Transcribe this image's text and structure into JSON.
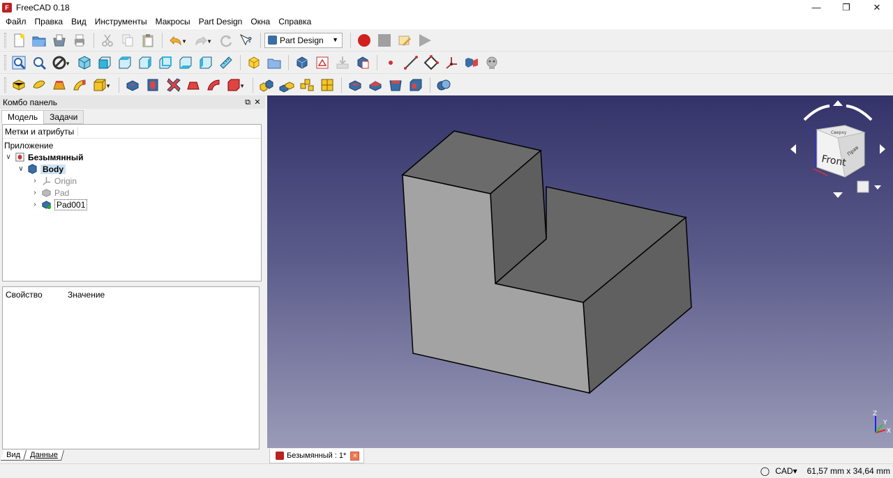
{
  "window": {
    "title": "FreeCAD 0.18",
    "app_icon_text": "F"
  },
  "menu": [
    "Файл",
    "Правка",
    "Вид",
    "Инструменты",
    "Макросы",
    "Part Design",
    "Окна",
    "Справка"
  ],
  "toolbar": {
    "workbench": "Part Design"
  },
  "combo": {
    "title": "Комбо панель",
    "tabs": [
      "Модель",
      "Задачи"
    ],
    "tree_header": "Метки и атрибуты",
    "app_label": "Приложение",
    "document": "Безымянный",
    "body": "Body",
    "children": [
      "Origin",
      "Pad",
      "Pad001"
    ],
    "prop_cols": [
      "Свойство",
      "Значение"
    ],
    "bottom_tabs": [
      "Вид",
      "Данные"
    ]
  },
  "view": {
    "tab_label": "Безымянный : 1*",
    "navcube_face": "Front",
    "navcube_right": "Прав",
    "navcube_top": "Сверху",
    "axis_labels": [
      "Z",
      "Y",
      "X"
    ]
  },
  "status": {
    "mode": "CAD",
    "dimensions": "61,57 mm x 34,64 mm"
  },
  "colors": {
    "accent": "#3a6ea5",
    "record": "#d22020",
    "view_top": "#33336a",
    "view_bottom": "#9a9ab8"
  }
}
